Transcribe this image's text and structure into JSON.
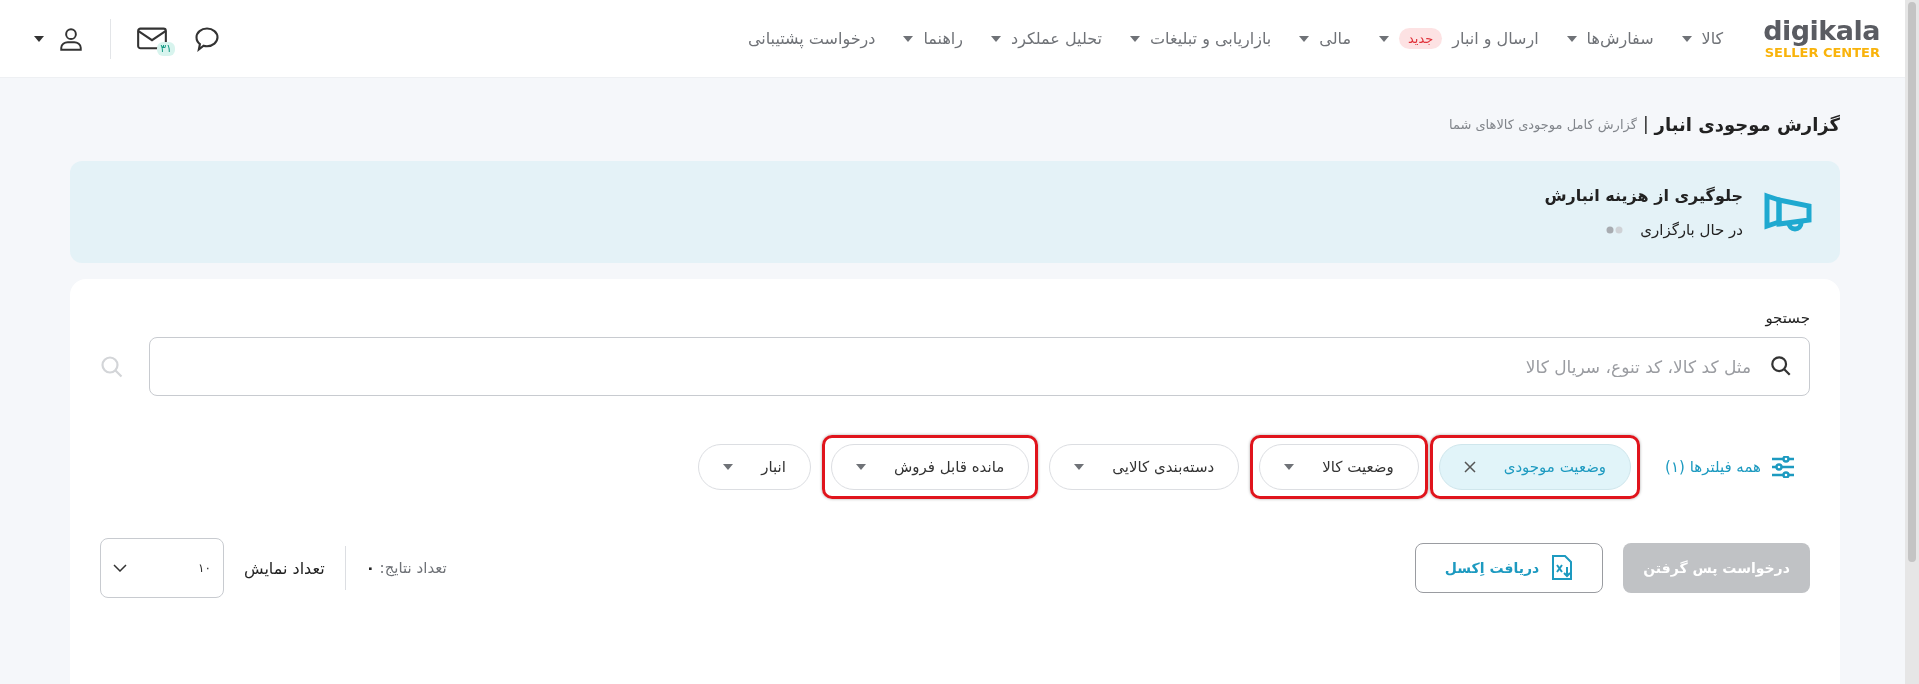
{
  "header": {
    "logo": {
      "word": "digikala",
      "tagline": "SELLER CENTER"
    },
    "nav": [
      {
        "label": "کالا",
        "dropdown": true
      },
      {
        "label": "سفارش‌ها",
        "dropdown": true
      },
      {
        "label": "ارسال و انبار",
        "badge": "جدید",
        "dropdown": true
      },
      {
        "label": "مالی",
        "dropdown": true
      },
      {
        "label": "بازاریابی و تبلیغات",
        "dropdown": true
      },
      {
        "label": "تحلیل عملکرد",
        "dropdown": true
      },
      {
        "label": "راهنما",
        "dropdown": true
      },
      {
        "label": "درخواست پشتیبانی",
        "dropdown": false
      }
    ],
    "mail_badge": "۳۱"
  },
  "page": {
    "title": "گزارش موجودی انبار",
    "separator": "|",
    "subtitle": "گزارش کامل موجودی کالاهای شما"
  },
  "banner": {
    "title": "جلوگیری از هزینه انبارش",
    "status": "در حال بارگزاری"
  },
  "search": {
    "label": "جستجو",
    "placeholder": "مثل کد کالا، کد تنوع، سریال کالا"
  },
  "all_filters": "همه فیلترها (۱)",
  "filters": [
    {
      "label": "وضعیت موجودی",
      "kind": "active",
      "highlighted": true
    },
    {
      "label": "وضعیت کالا",
      "kind": "dropdown",
      "highlighted": true
    },
    {
      "label": "دسته‌بندی کالایی",
      "kind": "dropdown",
      "highlighted": false
    },
    {
      "label": "مانده قابل فروش",
      "kind": "dropdown",
      "highlighted": true
    },
    {
      "label": "انبار",
      "kind": "dropdown",
      "highlighted": false
    }
  ],
  "actions": [
    {
      "label": "درخواست پس گرفتن",
      "kind": "primary",
      "disabled": true
    },
    {
      "label": "دریافت اِکسل",
      "kind": "excel"
    }
  ],
  "results": {
    "label": "تعداد نتایج:",
    "count": "۰"
  },
  "page_size": {
    "label": "تعداد نمایش",
    "value": "۱۰"
  }
}
